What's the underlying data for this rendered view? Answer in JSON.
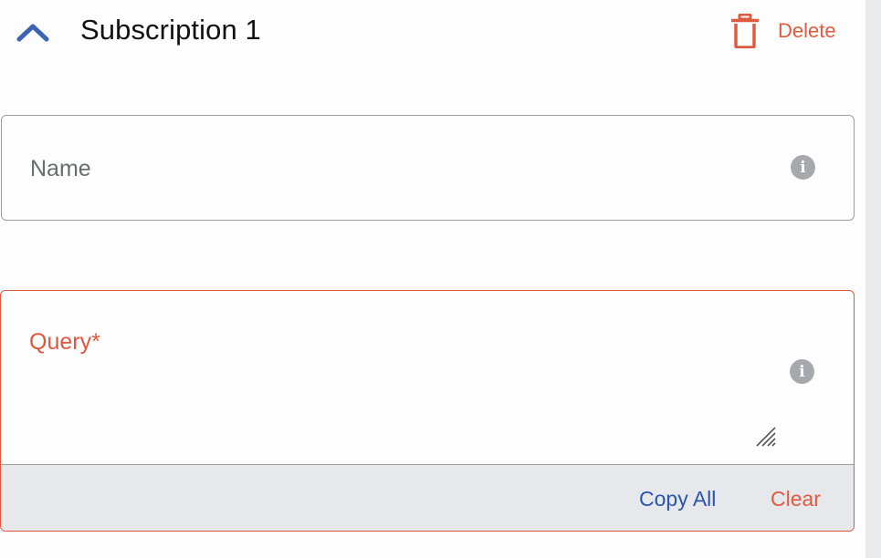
{
  "header": {
    "title": "Subscription 1",
    "collapse_icon": "chevron-up-icon",
    "delete_label": "Delete",
    "delete_icon": "trash-icon"
  },
  "name_field": {
    "label": "Name",
    "value": "",
    "info_icon": "info-icon"
  },
  "query_field": {
    "label": "Query*",
    "value": "",
    "info_icon": "info-icon",
    "resize_icon": "resize-handle-icon",
    "copy_all_label": "Copy All",
    "clear_label": "Clear"
  },
  "colors": {
    "accent_blue": "#2a56b0",
    "chevron_blue": "#3f63b4",
    "danger_red": "#e2563c",
    "border_gray": "#9a9c9e",
    "footer_bg": "#e6e8ec",
    "info_icon_gray": "#a5a8ad"
  }
}
